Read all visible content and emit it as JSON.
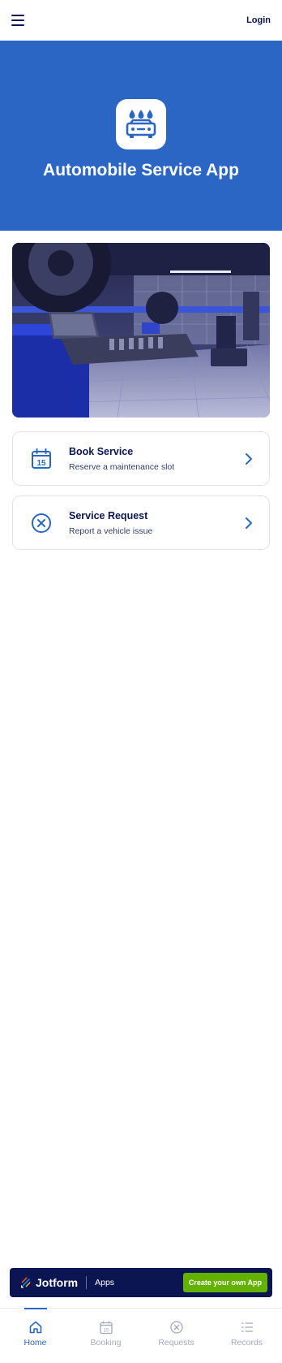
{
  "header": {
    "menu_icon": "hamburger-icon",
    "login_label": "Login"
  },
  "hero": {
    "app_icon": "car-wash-icon",
    "title": "Automobile Service App",
    "background": "#2b66c4"
  },
  "photo": {
    "subject": "auto repair garage with tire changer"
  },
  "cards": [
    {
      "icon": "calendar-icon",
      "icon_day": "15",
      "title": "Book Service",
      "subtitle": "Reserve a maintenance slot"
    },
    {
      "icon": "close-circle-icon",
      "title": "Service Request",
      "subtitle": "Report a vehicle issue"
    }
  ],
  "banner": {
    "brand": "Jotform",
    "section": "Apps",
    "cta_label": "Create your own App",
    "background": "#0a1551",
    "cta_color": "#64b200"
  },
  "tabbar": {
    "active": "Home",
    "tabs": [
      {
        "label": "Home",
        "icon": "home-icon"
      },
      {
        "label": "Booking",
        "icon": "calendar-icon",
        "icon_day": "15"
      },
      {
        "label": "Requests",
        "icon": "close-circle-icon"
      },
      {
        "label": "Records",
        "icon": "list-icon"
      }
    ]
  }
}
